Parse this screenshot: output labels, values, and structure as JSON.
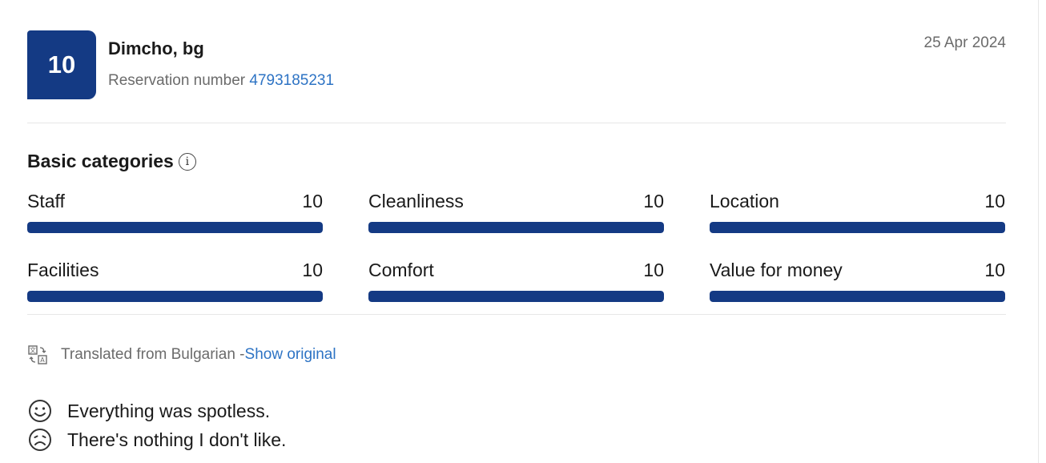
{
  "review": {
    "score": "10",
    "reviewer": "Dimcho, bg",
    "reservation_label": "Reservation number",
    "reservation_number": "4793185231",
    "date": "25 Apr 2024"
  },
  "categories": {
    "heading": "Basic categories",
    "info_icon": "info-icon",
    "max_score": 10,
    "items": [
      {
        "label": "Staff",
        "score": "10"
      },
      {
        "label": "Cleanliness",
        "score": "10"
      },
      {
        "label": "Location",
        "score": "10"
      },
      {
        "label": "Facilities",
        "score": "10"
      },
      {
        "label": "Comfort",
        "score": "10"
      },
      {
        "label": "Value for money",
        "score": "10"
      }
    ],
    "bar_color": "#143a84"
  },
  "translation": {
    "icon": "translate-icon",
    "text": "Translated from Bulgarian - ",
    "link": "Show original"
  },
  "comments": {
    "positive": {
      "icon": "smile-icon",
      "text": "Everything was spotless."
    },
    "negative": {
      "icon": "frown-icon",
      "text": "There's nothing I don't like."
    }
  },
  "colors": {
    "brand": "#143a84",
    "link": "#2d73c4",
    "muted_text": "#6b6b6b"
  }
}
